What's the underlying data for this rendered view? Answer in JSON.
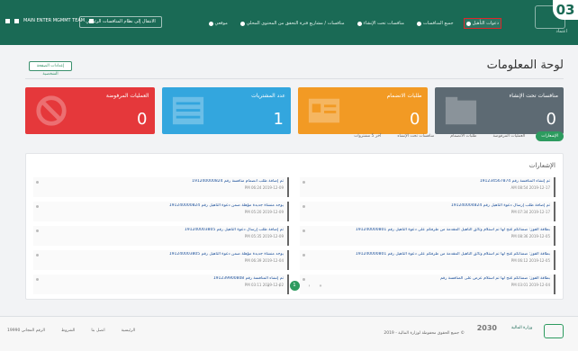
{
  "badge": "03",
  "brand": {
    "logo_text": "اعتماد"
  },
  "nav": [
    {
      "label": "دعوات التأهيل",
      "active": true
    },
    {
      "label": "جميع المنافسات",
      "active": false
    },
    {
      "label": "منافسات تحت الإنشاء",
      "active": false
    },
    {
      "label": "منافسات / مشاريع فترة التحقق من المحتوى المحلي",
      "active": false
    },
    {
      "label": "موقعي",
      "active": false
    }
  ],
  "header": {
    "switch_label": "الانتقال إلى نظام المنافسات الرئيسي",
    "user_name": "MAIN ENTER MGMMT TEAM"
  },
  "page": {
    "title": "لوحة المعلومات",
    "print_label": "إعدادات الصفحة الشخصية"
  },
  "cards": [
    {
      "label": "منافسات تحت الإنشاء",
      "value": "0",
      "color": "#5d6a73"
    },
    {
      "label": "طلبات الانضمام",
      "value": "0",
      "color": "#f29a24"
    },
    {
      "label": "عدد المشتريات",
      "value": "1",
      "color": "#33a6de"
    },
    {
      "label": "العمليات المرفوضة",
      "value": "0",
      "color": "#e5383b"
    }
  ],
  "tabs": [
    {
      "label": "الإشعارات",
      "active": true
    },
    {
      "label": "العمليات المرفوضة",
      "active": false
    },
    {
      "label": "طلبات الانضمام",
      "active": false
    },
    {
      "label": "منافسات تحت الإنشاء",
      "active": false
    },
    {
      "label": "آخر 5 مشتروات",
      "active": false
    }
  ],
  "notifications": {
    "title": "الإشعارات",
    "items": [
      {
        "title": "تم إنشاء المنافسة رقم 191234567874",
        "date": "2019-12-17 08:54 AM"
      },
      {
        "title": "تم إضافة طلب انضمام منافسة رقم 191240000824",
        "date": "2019-12-09 06:24 PM"
      },
      {
        "title": "تم إضافة طلب إرسال دعوة التأهيل رقم 191240004824",
        "date": "2019-12-17 07:34 PM"
      },
      {
        "title": "يوجد منشأة جديدة مؤهلة ضمن دعوة التأهيل رقم 191240000824",
        "date": "2019-12-09 05:20 PM"
      },
      {
        "title": "بطاقة الفوز: ضمناتكم مُنح لها تم استلام وثائق التأهيل المقدمة من طرفكم على دعوة التأهيل رقم 191240000801",
        "date": "2019-12-05 08:36 PM"
      },
      {
        "title": "تم إضافة طلب إرسال دعوة التأهيل رقم 191240003805",
        "date": "2019-12-09 05:35 PM"
      },
      {
        "title": "بطاقة الفوز: ضمناتكم مُنح لها تم استلام وثائق التأهيل المقدمة من طرفكم على دعوة التأهيل رقم 191240000801",
        "date": "2019-12-05 06:12 PM"
      },
      {
        "title": "يوجد منشأة جديدة مؤهلة ضمن دعوة التأهيل رقم 191240003805",
        "date": "2019-12-04 06:39 PM"
      },
      {
        "title": "بطاقة الفوز: ضمناتكم مُنح لها تم استلام عرض على المنافسة رقم",
        "date": "2019-12-04 03:01 PM"
      },
      {
        "title": "تم إنشاء المنافسة رقم 191239900808",
        "date": "2019-12-02 03:11 PM"
      }
    ]
  },
  "pagination": {
    "prev": "«",
    "prev2": "‹",
    "current": "1",
    "next": "›",
    "next2": "»"
  },
  "footer": {
    "ministry": "وزارة المالية",
    "vision": "2030",
    "copyright": "جميع الحقوق محفوظة لوزارة المالية - 2019 ©",
    "links": [
      "الرئيسية",
      "اتصل بنا",
      "الشروط",
      "الرقم المجاني 19990"
    ]
  }
}
